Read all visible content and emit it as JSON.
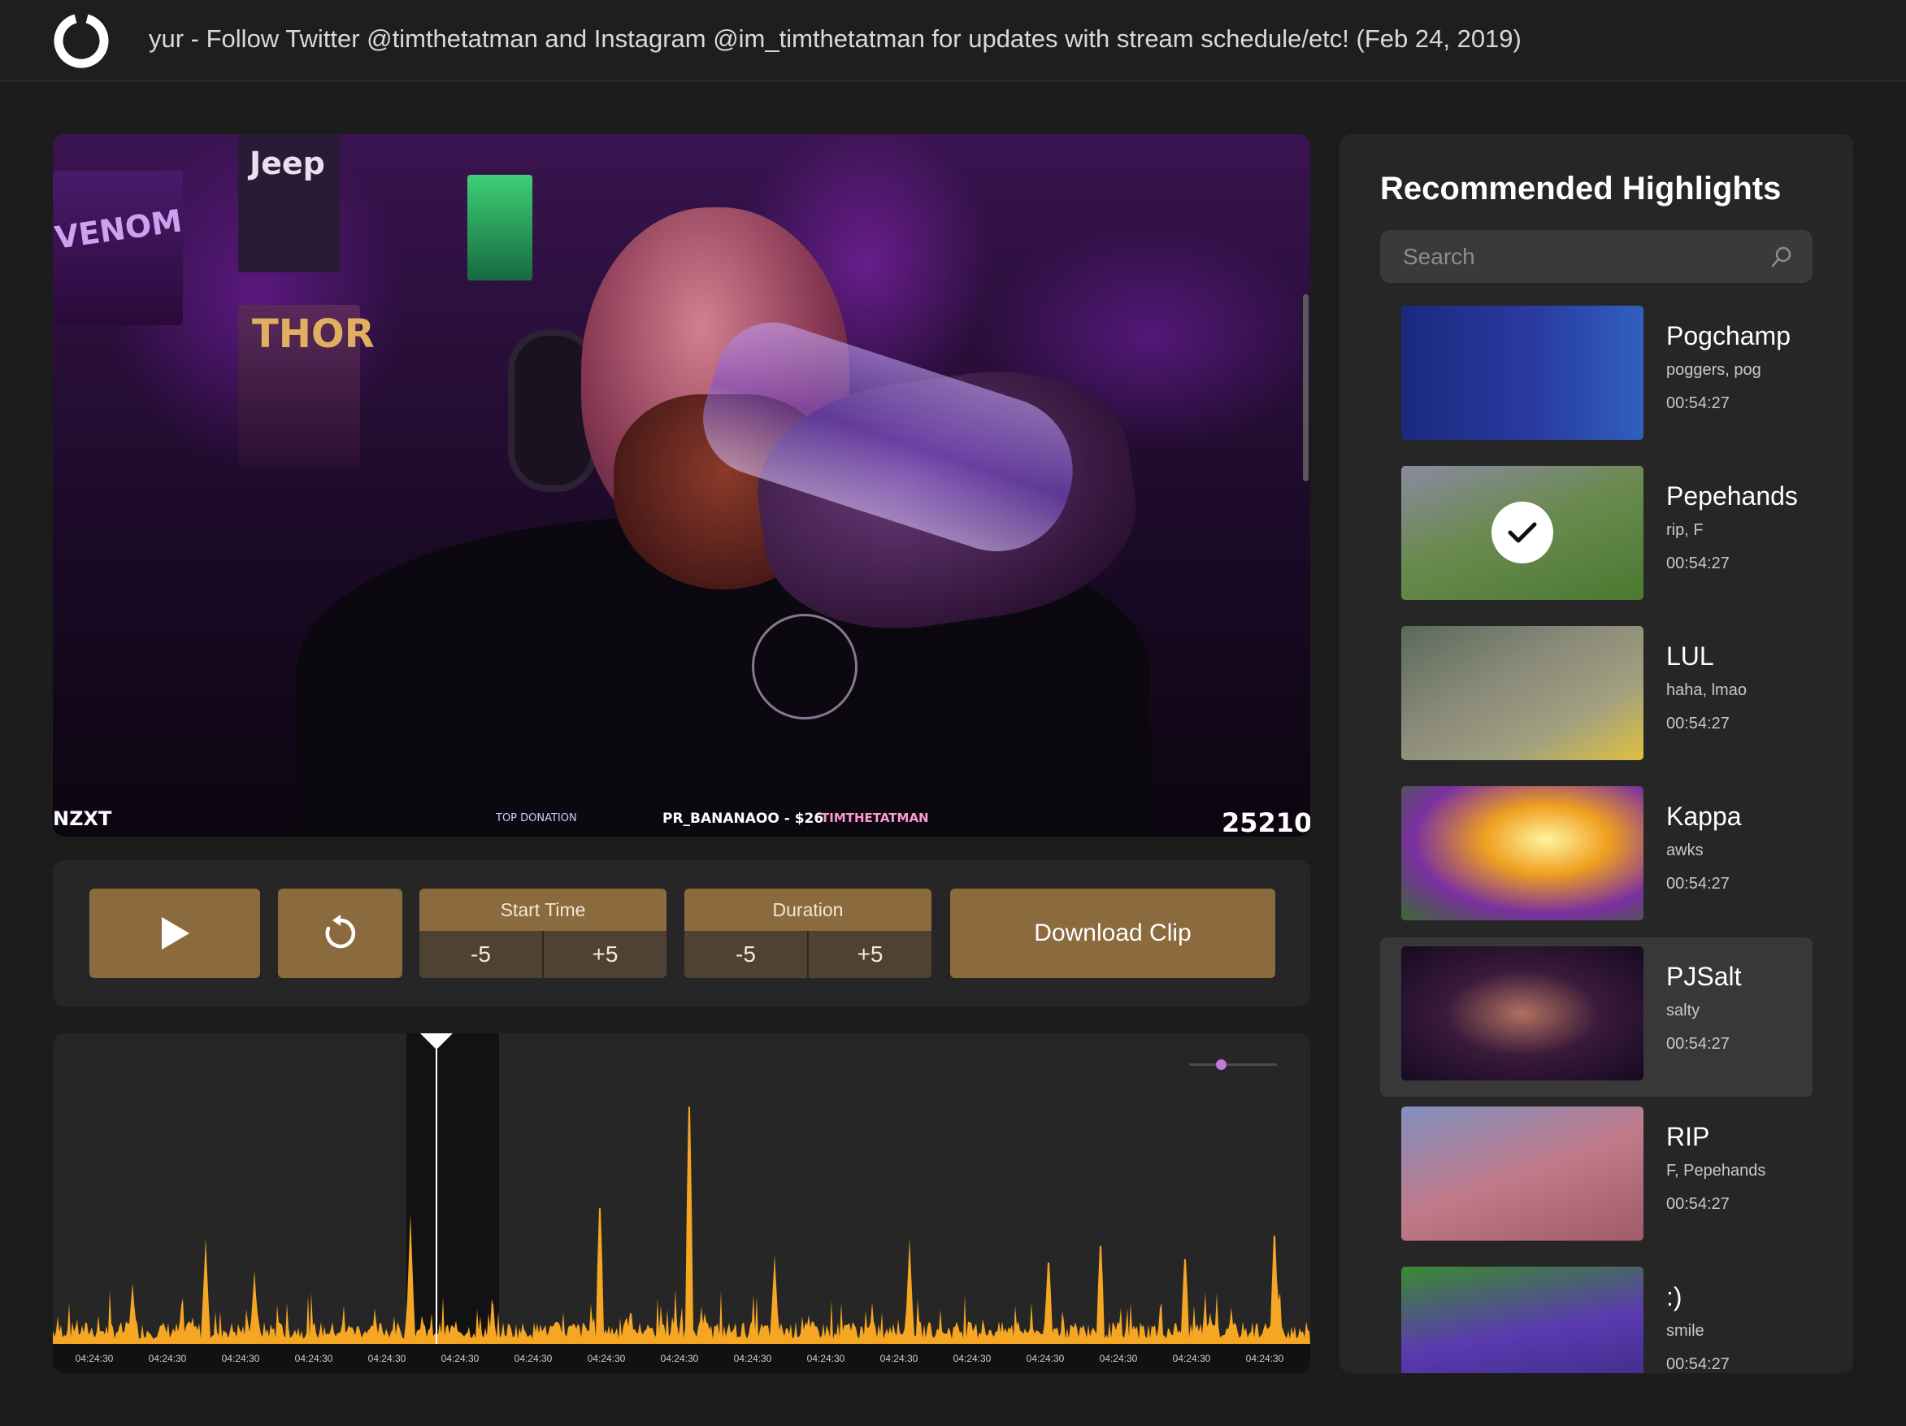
{
  "header": {
    "title": "yur - Follow Twitter @timthetatman and Instagram @im_timthetatman for updates with stream schedule/etc! (Feb 24, 2019)",
    "logo_icon": "power-ring-logo"
  },
  "video": {
    "overlay_brand": "NZXT",
    "overlay_donation_label": "TOP DONATION",
    "overlay_donation_text": "PR_BANANAOO - $26",
    "overlay_channel": "TIMTHETATMAN",
    "overlay_count": "25210",
    "overlay_poster_jeep": "Jeep",
    "overlay_poster_venom": "VENOM",
    "overlay_poster_thor": "THOR"
  },
  "controls": {
    "play_icon": "play-icon",
    "replay_icon": "replay-icon",
    "start_time": {
      "label": "Start Time",
      "minus": "-5",
      "plus": "+5"
    },
    "duration": {
      "label": "Duration",
      "minus": "-5",
      "plus": "+5"
    },
    "download_label": "Download Clip",
    "accent_color": "#8b6b3e"
  },
  "timeline": {
    "waveform_color": "#f5a623",
    "tick_labels": [
      "04:24:30",
      "04:24:30",
      "04:24:30",
      "04:24:30",
      "04:24:30",
      "04:24:30",
      "04:24:30",
      "04:24:30",
      "04:24:30",
      "04:24:30",
      "04:24:30",
      "04:24:30",
      "04:24:30",
      "04:24:30",
      "04:24:30",
      "04:24:30",
      "04:24:30"
    ],
    "zoom_color": "#c07ad8"
  },
  "sidebar": {
    "title": "Recommended Highlights",
    "search_placeholder": "Search",
    "items": [
      {
        "name": "Pogchamp",
        "tags": "poggers, pog",
        "time": "00:54:27",
        "theme": "fortnite-locker"
      },
      {
        "name": "Pepehands",
        "tags": "rip, F",
        "time": "00:54:27",
        "theme": "fortnite-field",
        "checked": true
      },
      {
        "name": "LUL",
        "tags": "haha, lmao",
        "time": "00:54:27",
        "theme": "fortnite-build"
      },
      {
        "name": "Kappa",
        "tags": "awks",
        "time": "00:54:27",
        "theme": "fortnite-explosion"
      },
      {
        "name": "PJSalt",
        "tags": "salty",
        "time": "00:54:27",
        "theme": "webcam",
        "active": true
      },
      {
        "name": "RIP",
        "tags": "F, Pepehands",
        "time": "00:54:27",
        "theme": "fortnite-ramp"
      },
      {
        "name": ":)",
        "tags": "smile",
        "time": "00:54:27",
        "theme": "fortnite-purple"
      }
    ]
  }
}
